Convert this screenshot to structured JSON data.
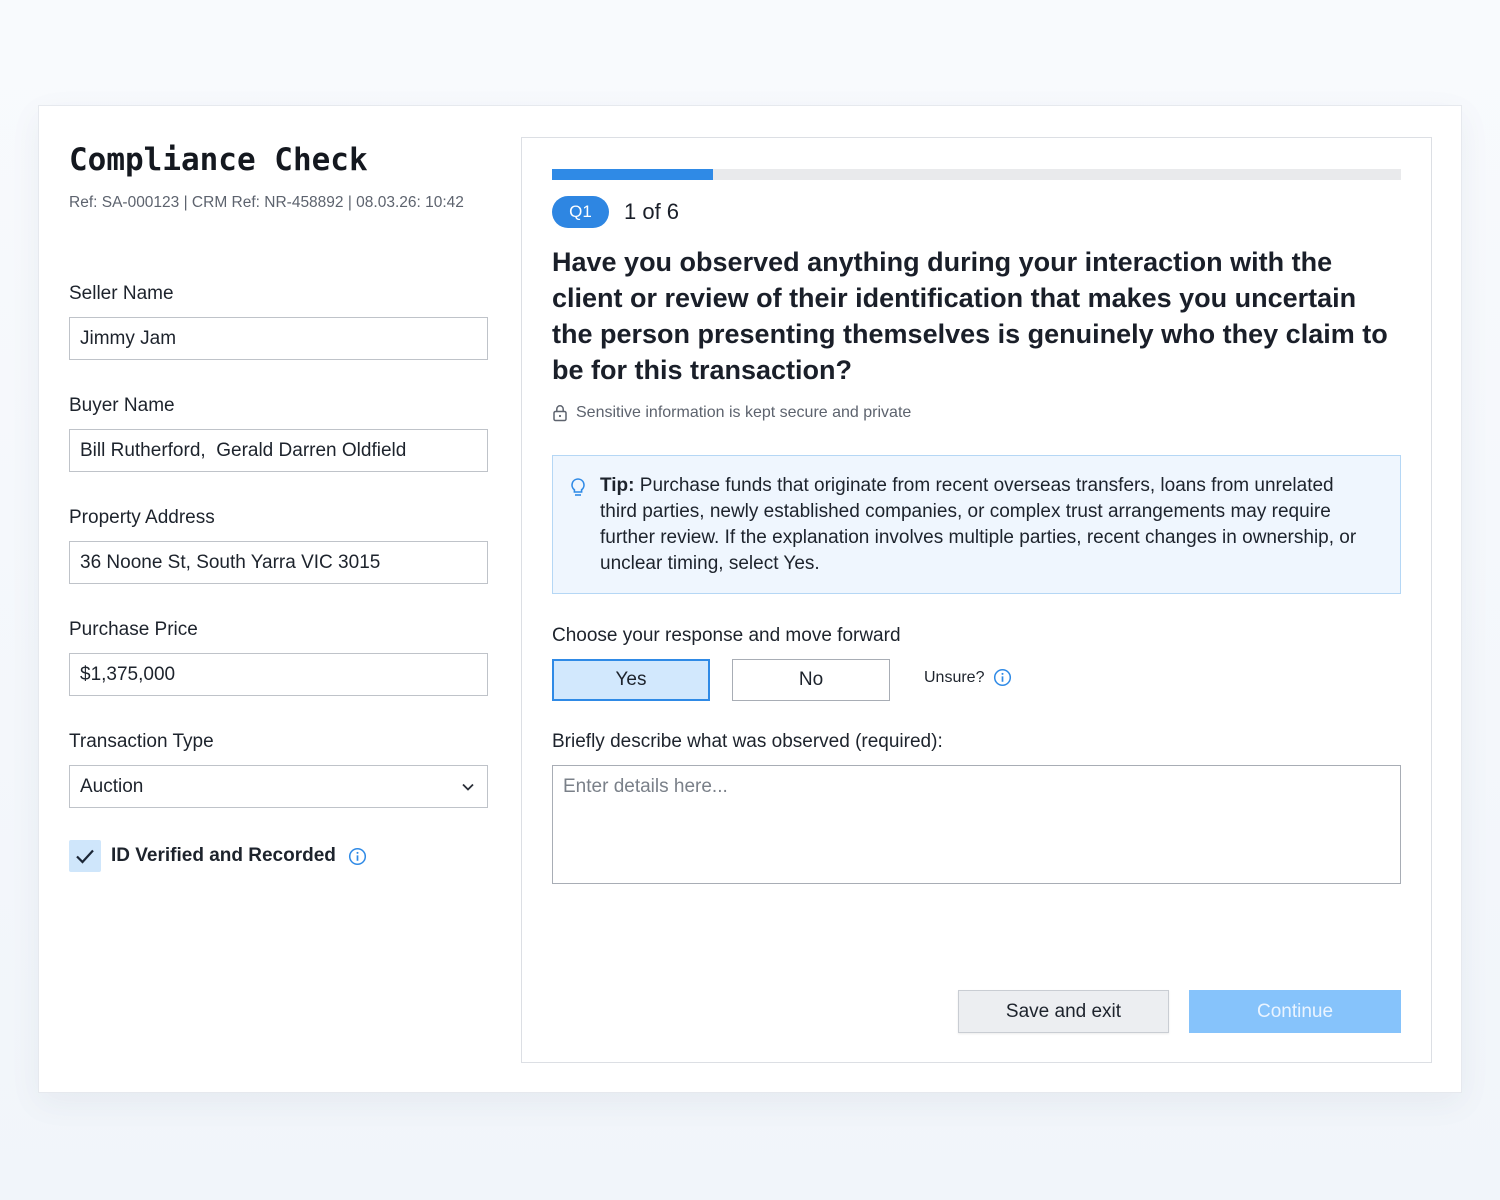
{
  "form": {
    "title": "Compliance Check",
    "meta": "Ref: SA-000123 | CRM Ref: NR-458892 | 08.03.26: 10:42",
    "fields": [
      {
        "label": "Seller Name",
        "value": "Jimmy Jam"
      },
      {
        "label": "Buyer Name",
        "value": "Bill Rutherford,  Gerald Darren Oldfield"
      },
      {
        "label": "Property Address",
        "value": "36 Noone St, South Yarra VIC 3015"
      },
      {
        "label": "Purchase Price",
        "value": "$1,375,000"
      },
      {
        "label": "Transaction Type",
        "value": "Auction"
      }
    ],
    "id_verified": {
      "label": "ID Verified and Recorded",
      "checked": true
    }
  },
  "question_panel": {
    "progress": 0.19,
    "badge": "Q1",
    "count": "1 of 6",
    "question": "Have you observed anything during your interaction with the client or review of their identification that makes you uncertain the person presenting themselves is genuinely who they claim to be for this transaction?",
    "secure_note": "Sensitive information is kept secure and private",
    "tip_label": "Tip:",
    "tip_text": "Purchase funds that originate from recent overseas transfers, loans from unrelated third parties, newly established companies, or complex trust arrangements may require further review. If the explanation involves multiple parties, recent changes in ownership, or unclear timing, select Yes.",
    "choose_label": "Choose your response and move forward",
    "yes_label": "Yes",
    "no_label": "No",
    "selected": "Yes",
    "unsure_label": "Unsure?",
    "describe_label": "Briefly describe what was observed (required):",
    "details_placeholder": "Enter details here...",
    "save_label": "Save and exit",
    "continue_label": "Continue"
  },
  "colors": {
    "accent": "#2f8ae6",
    "selected_bg": "#d2e8fd",
    "tip_bg": "#eff6fe",
    "continue_disabled": "#86c3fb"
  },
  "icons": {
    "dropdown": "chevron-down-icon",
    "checkbox": "checkmark-icon",
    "info": "info-icon",
    "lock": "lock-icon",
    "tip": "lightbulb-icon"
  }
}
